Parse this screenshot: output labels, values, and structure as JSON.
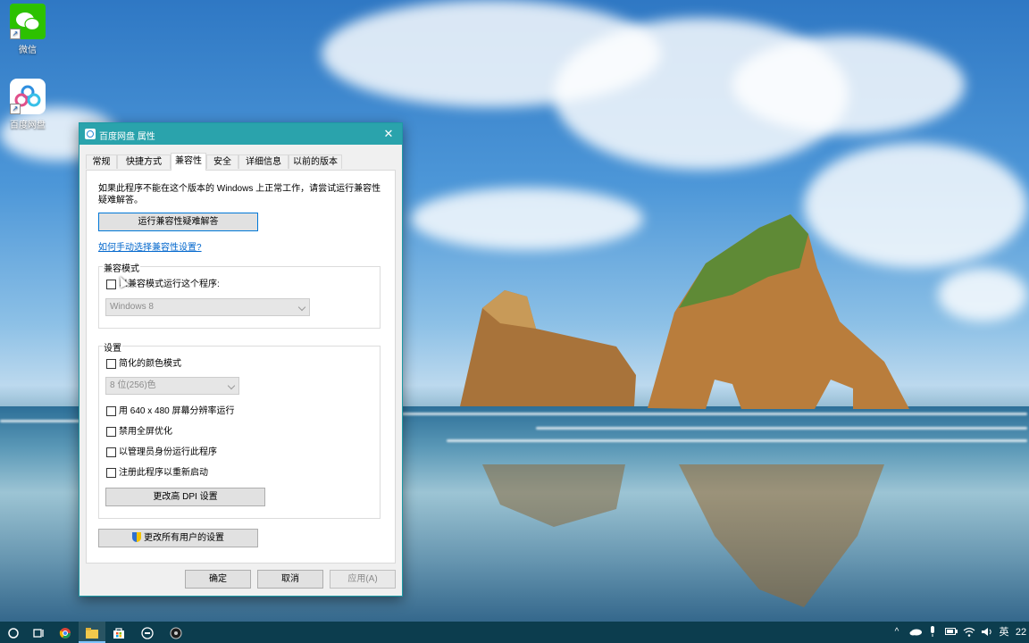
{
  "desktop": {
    "icons": [
      {
        "label": "微信"
      },
      {
        "label": "百度网盘"
      }
    ]
  },
  "dialog": {
    "title": "百度网盘 属性",
    "tabs": [
      "常规",
      "快捷方式",
      "兼容性",
      "安全",
      "详细信息",
      "以前的版本"
    ],
    "active_tab": "兼容性",
    "intro_text": "如果此程序不能在这个版本的 Windows 上正常工作，请尝试运行兼容性疑难解答。",
    "troubleshooter_button": "运行兼容性疑难解答",
    "manual_link": "如何手动选择兼容性设置?",
    "compat_mode": {
      "group_label": "兼容模式",
      "checkbox_label": "以兼容模式运行这个程序:",
      "checked": false,
      "os_select_value": "Windows 8"
    },
    "settings": {
      "group_label": "设置",
      "reduced_color": {
        "label": "简化的颜色模式",
        "checked": false
      },
      "color_select_value": "8 位(256)色",
      "res_640": {
        "label": "用 640 x 480 屏幕分辨率运行",
        "checked": false
      },
      "disable_fullscreen_opt": {
        "label": "禁用全屏优化",
        "checked": false
      },
      "run_as_admin": {
        "label": "以管理员身份运行此程序",
        "checked": false
      },
      "register_restart": {
        "label": "注册此程序以重新启动",
        "checked": false
      },
      "dpi_button": "更改高 DPI 设置"
    },
    "all_users_button": "更改所有用户的设置",
    "footer": {
      "ok": "确定",
      "cancel": "取消",
      "apply": "应用(A)"
    }
  },
  "taskbar": {
    "tray": {
      "ime": "英",
      "clock_partial": "22"
    }
  },
  "colors": {
    "titlebar": "#2aa3ac",
    "taskbar": "#0c3d4e",
    "link": "#0066cc"
  }
}
